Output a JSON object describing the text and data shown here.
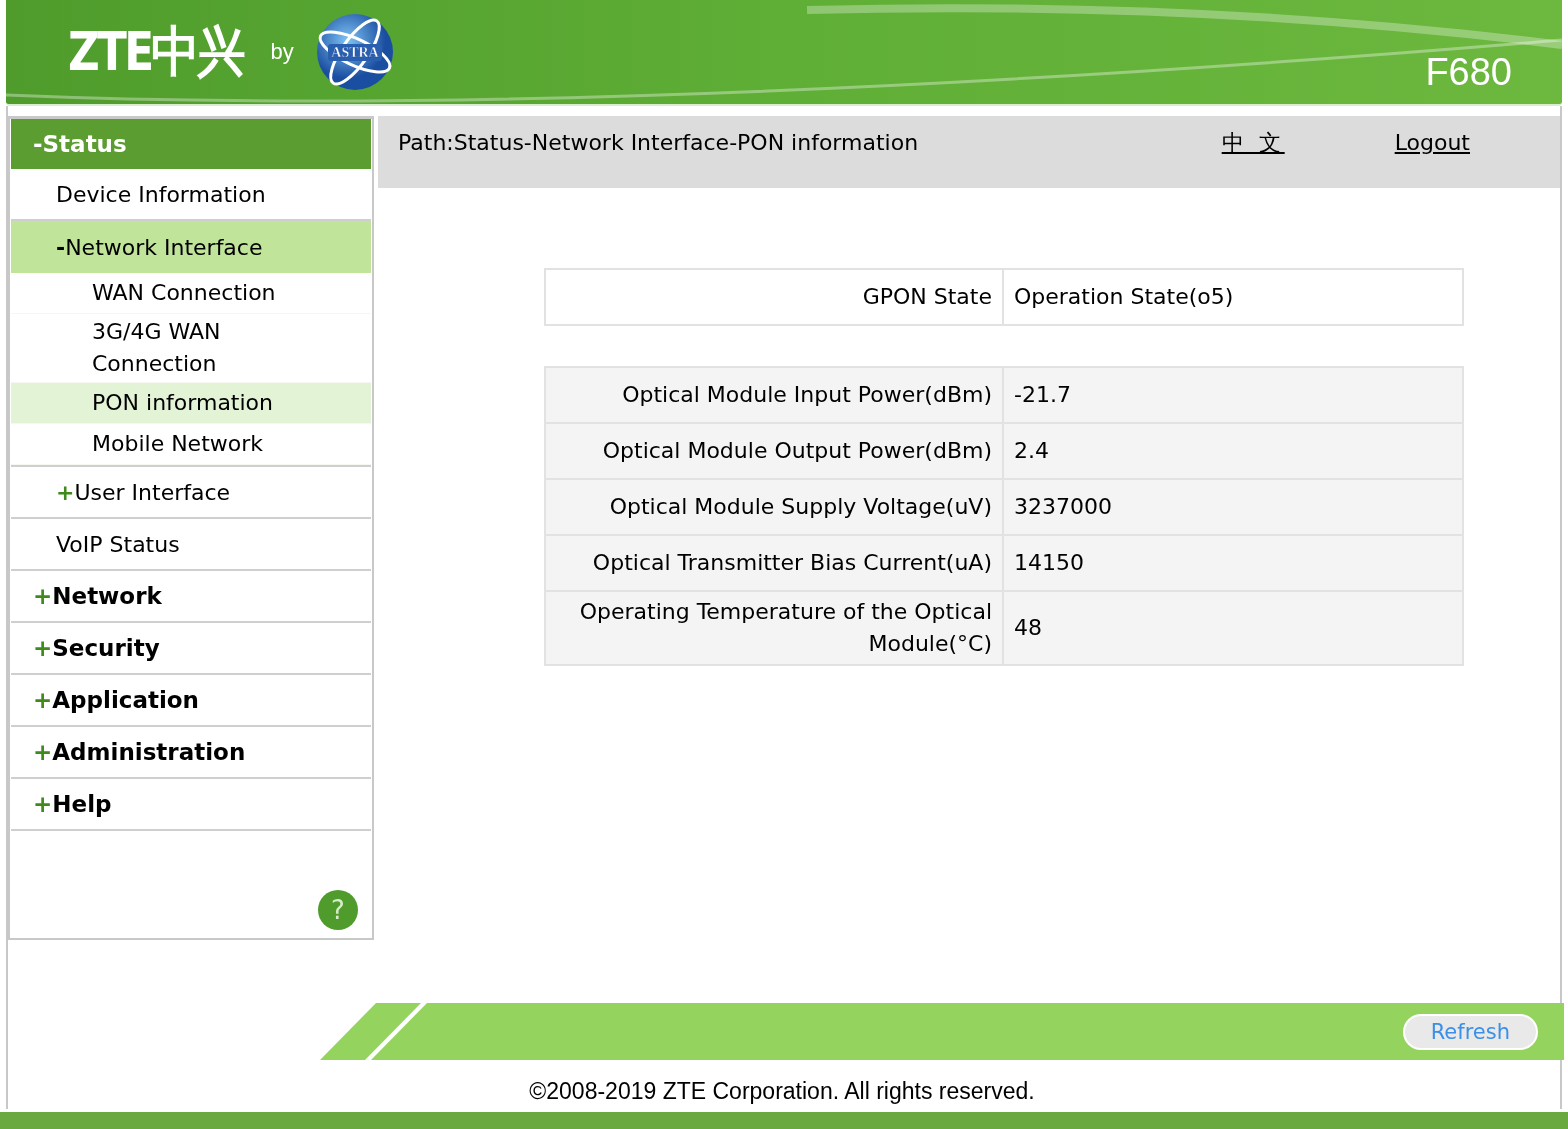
{
  "header": {
    "brand": "ZTE中兴",
    "by": "by",
    "partner": "ASTRA",
    "model": "F680"
  },
  "menu": [
    {
      "label": "Status",
      "toggle": "-",
      "expanded": true,
      "selected": false,
      "children": [
        {
          "label": "Device Information",
          "selected": false
        },
        {
          "label": "Network Interface",
          "toggle": "-",
          "expanded": true,
          "selected": false,
          "children": [
            {
              "label": "WAN Connection",
              "selected": false
            },
            {
              "label": "3G/4G WAN Connection",
              "selected": false
            },
            {
              "label": "PON information",
              "selected": true
            },
            {
              "label": "Mobile Network",
              "selected": false
            }
          ]
        },
        {
          "label": "User Interface",
          "toggle": "+",
          "expanded": false,
          "selected": false
        },
        {
          "label": "VoIP Status",
          "selected": false
        }
      ]
    },
    {
      "label": "Network",
      "toggle": "+",
      "expanded": false,
      "selected": false
    },
    {
      "label": "Security",
      "toggle": "+",
      "expanded": false,
      "selected": false
    },
    {
      "label": "Application",
      "toggle": "+",
      "expanded": false,
      "selected": false
    },
    {
      "label": "Administration",
      "toggle": "+",
      "expanded": false,
      "selected": false
    },
    {
      "label": "Help",
      "toggle": "+",
      "expanded": false,
      "selected": false
    }
  ],
  "help_icon": "?",
  "path_bar": {
    "path": "Path:Status-Network Interface-PON information",
    "language_link": "中 文",
    "logout_link": "Logout"
  },
  "state_table": [
    {
      "label": "GPON State",
      "value": "Operation State(o5)"
    }
  ],
  "optical_table": [
    {
      "label": "Optical Module Input Power(dBm)",
      "value": "-21.7"
    },
    {
      "label": "Optical Module Output Power(dBm)",
      "value": "2.4"
    },
    {
      "label": "Optical Module Supply Voltage(uV)",
      "value": "3237000"
    },
    {
      "label": "Optical Transmitter Bias Current(uA)",
      "value": "14150"
    },
    {
      "label": "Operating Temperature of the Optical Module(°C)",
      "value": "48"
    }
  ],
  "refresh_button": "Refresh",
  "copyright": "©2008-2019 ZTE Corporation. All rights reserved."
}
